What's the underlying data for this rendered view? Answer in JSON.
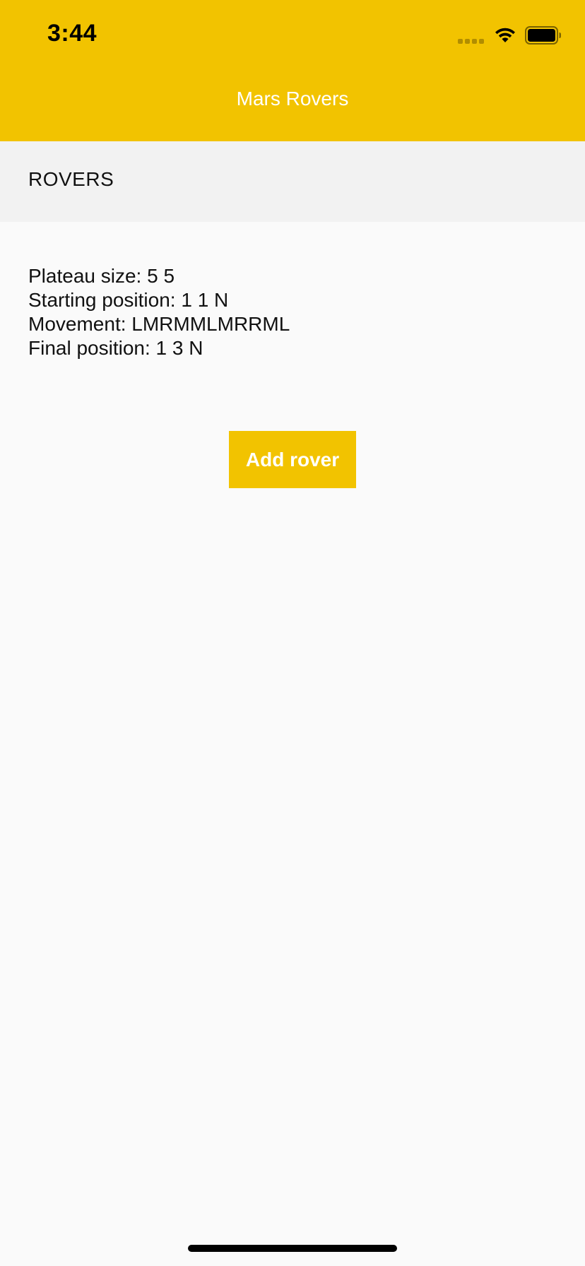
{
  "status_bar": {
    "time": "3:44",
    "icons": [
      "cellular-signal-icon",
      "wifi-icon",
      "battery-icon"
    ]
  },
  "header": {
    "title": "Mars Rovers"
  },
  "section": {
    "title": "ROVERS"
  },
  "rover": {
    "plateau": "Plateau size: 5 5",
    "start": "Starting position: 1 1 N",
    "movement": "Movement: LMRMMLMRRML",
    "final": "Final position: 1 3 N"
  },
  "actions": {
    "add_rover_label": "Add rover"
  },
  "colors": {
    "accent": "#f2c300",
    "background": "#fafafa",
    "section_bar": "#f2f2f2",
    "header_text": "#ffffff"
  }
}
